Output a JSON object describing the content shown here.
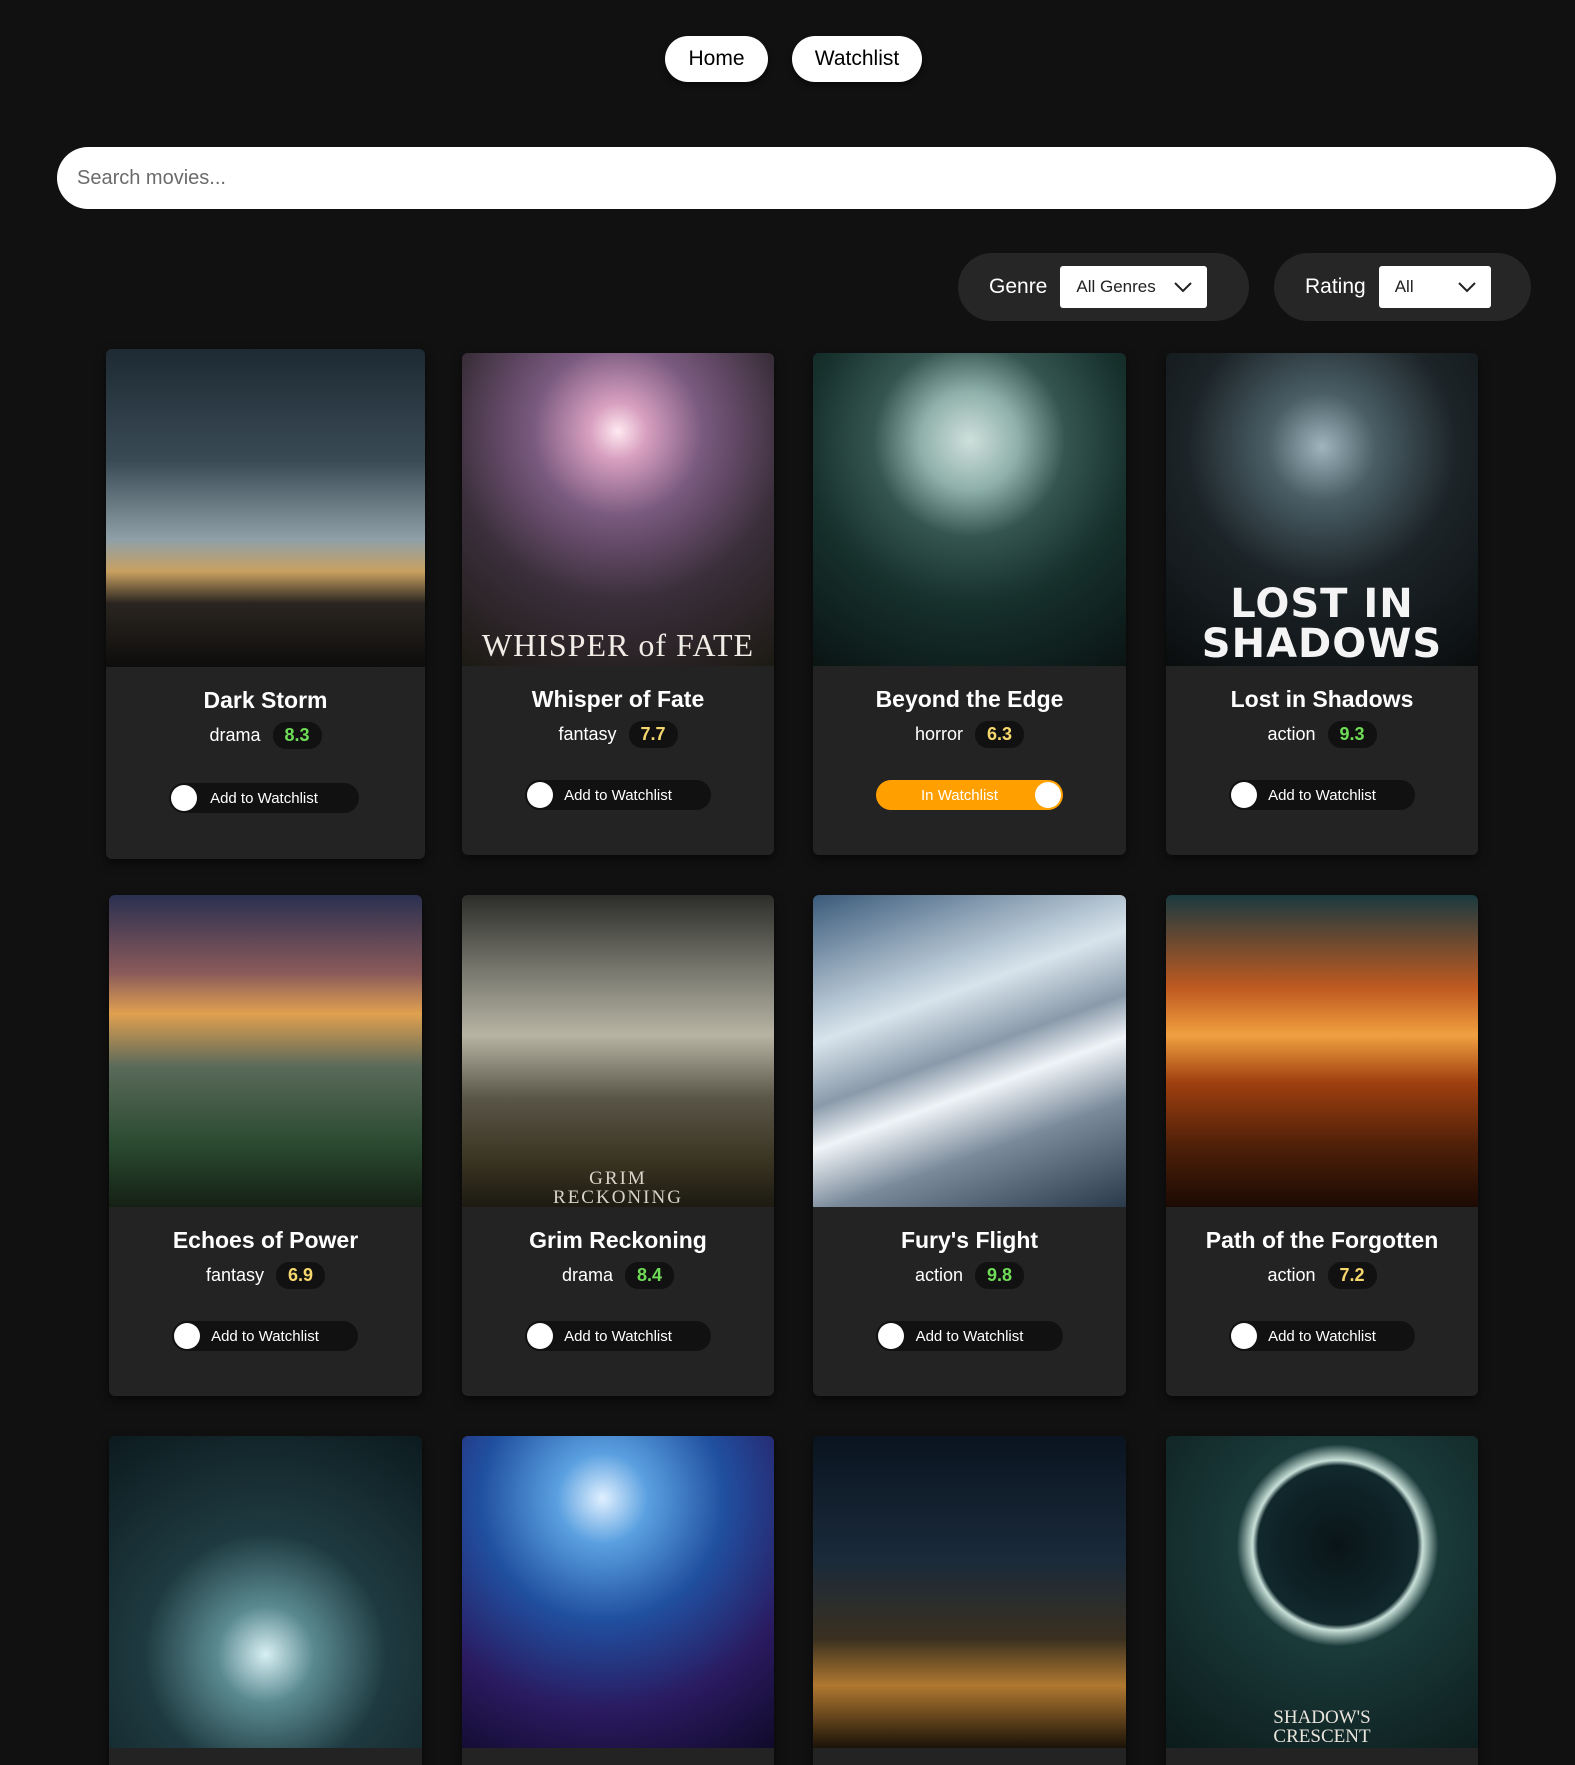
{
  "nav": {
    "home": "Home",
    "watchlist": "Watchlist"
  },
  "search": {
    "placeholder": "Search movies..."
  },
  "filters": {
    "genre_label": "Genre",
    "genre_value": "All Genres",
    "rating_label": "Rating",
    "rating_value": "All"
  },
  "colors": {
    "rating_high": "#6fdc57",
    "rating_mid": "#f5d76e",
    "watchlist_on": "#ffa000"
  },
  "movies": [
    {
      "title": "Dark Storm",
      "genre": "drama",
      "rating": "8.3",
      "rating_level": "high",
      "watchlist": "Add to Watchlist",
      "in_watchlist": false,
      "poster_text": ""
    },
    {
      "title": "Whisper of Fate",
      "genre": "fantasy",
      "rating": "7.7",
      "rating_level": "mid",
      "watchlist": "Add to Watchlist",
      "in_watchlist": false,
      "poster_text": "WHISPER of FATE"
    },
    {
      "title": "Beyond the Edge",
      "genre": "horror",
      "rating": "6.3",
      "rating_level": "mid",
      "watchlist": "In Watchlist",
      "in_watchlist": true,
      "poster_text": ""
    },
    {
      "title": "Lost in Shadows",
      "genre": "action",
      "rating": "9.3",
      "rating_level": "high",
      "watchlist": "Add to Watchlist",
      "in_watchlist": false,
      "poster_text": "LOST IN SHADOWS"
    },
    {
      "title": "Echoes of Power",
      "genre": "fantasy",
      "rating": "6.9",
      "rating_level": "mid",
      "watchlist": "Add to Watchlist",
      "in_watchlist": false,
      "poster_text": ""
    },
    {
      "title": "Grim Reckoning",
      "genre": "drama",
      "rating": "8.4",
      "rating_level": "high",
      "watchlist": "Add to Watchlist",
      "in_watchlist": false,
      "poster_text": "GRIM RECKONING"
    },
    {
      "title": "Fury's Flight",
      "genre": "action",
      "rating": "9.8",
      "rating_level": "high",
      "watchlist": "Add to Watchlist",
      "in_watchlist": false,
      "poster_text": ""
    },
    {
      "title": "Path of the Forgotten",
      "genre": "action",
      "rating": "7.2",
      "rating_level": "mid",
      "watchlist": "Add to Watchlist",
      "in_watchlist": false,
      "poster_text": ""
    },
    {
      "poster_text": ""
    },
    {
      "poster_text": ""
    },
    {
      "poster_text": ""
    },
    {
      "poster_text": "SHADOW'S CRESCENT"
    }
  ]
}
